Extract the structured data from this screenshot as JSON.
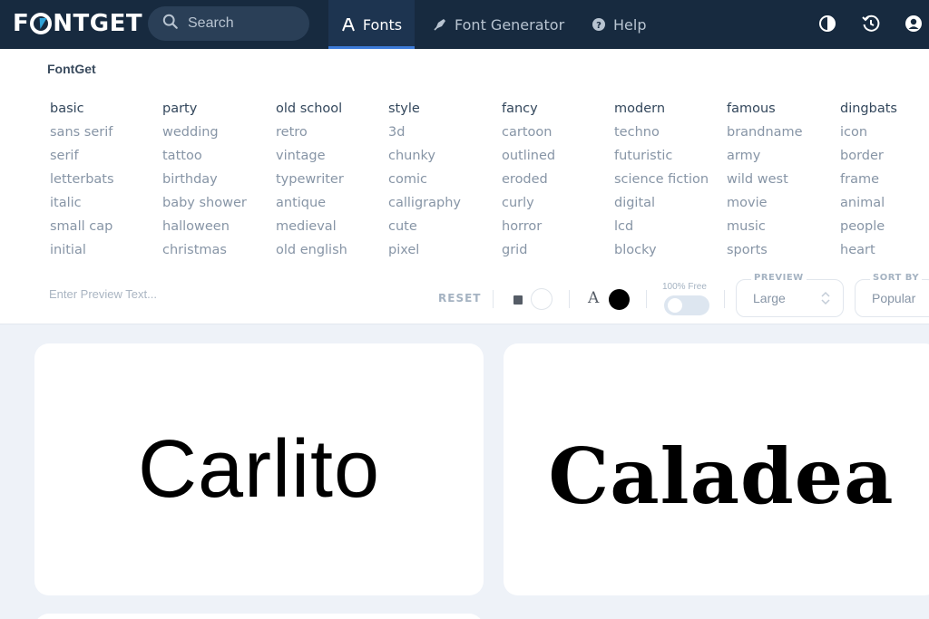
{
  "brand": {
    "logo_text_left": "F",
    "logo_text_right": "NTGET",
    "panel_label": "FontGet"
  },
  "search": {
    "placeholder": "Search",
    "icon": "search-icon"
  },
  "nav": [
    {
      "label": "Fonts",
      "icon": "font-icon",
      "active": true
    },
    {
      "label": "Font Generator",
      "icon": "pen-nib-icon",
      "active": false
    },
    {
      "label": "Help",
      "icon": "help-circle-icon",
      "active": false
    }
  ],
  "top_actions": [
    "contrast-icon",
    "history-icon",
    "account-icon"
  ],
  "categories": [
    {
      "heading": "basic",
      "items": [
        "sans serif",
        "serif",
        "letterbats",
        "italic",
        "small cap",
        "initial"
      ]
    },
    {
      "heading": "party",
      "items": [
        "wedding",
        "tattoo",
        "birthday",
        "baby shower",
        "halloween",
        "christmas"
      ]
    },
    {
      "heading": "old school",
      "items": [
        "retro",
        "vintage",
        "typewriter",
        "antique",
        "medieval",
        "old english"
      ]
    },
    {
      "heading": "style",
      "items": [
        "3d",
        "chunky",
        "comic",
        "calligraphy",
        "cute",
        "pixel"
      ]
    },
    {
      "heading": "fancy",
      "items": [
        "cartoon",
        "outlined",
        "eroded",
        "curly",
        "horror",
        "grid"
      ]
    },
    {
      "heading": "modern",
      "items": [
        "techno",
        "futuristic",
        "science fiction",
        "digital",
        "lcd",
        "blocky"
      ]
    },
    {
      "heading": "famous",
      "items": [
        "brandname",
        "army",
        "wild west",
        "movie",
        "music",
        "sports"
      ]
    },
    {
      "heading": "dingbats",
      "items": [
        "icon",
        "border",
        "frame",
        "animal",
        "people",
        "heart"
      ]
    }
  ],
  "controls": {
    "preview_placeholder": "Enter Preview Text...",
    "reset_label": "RESET",
    "free_label": "100% Free",
    "free_toggle_on": false,
    "background_color": "#ffffff",
    "text_color": "#000000",
    "text_color_letter": "A",
    "preview_size": {
      "label": "PREVIEW",
      "value": "Large"
    },
    "sort_by": {
      "label": "SORT BY",
      "value": "Popular"
    }
  },
  "cards": [
    {
      "font_name": "Carlito"
    },
    {
      "font_name": "Caladea"
    }
  ],
  "colors": {
    "topbar": "#172a3f",
    "accent": "#3d7bd9",
    "logo_accent": "#2fa3d8",
    "page_bg": "#eef2f8"
  }
}
